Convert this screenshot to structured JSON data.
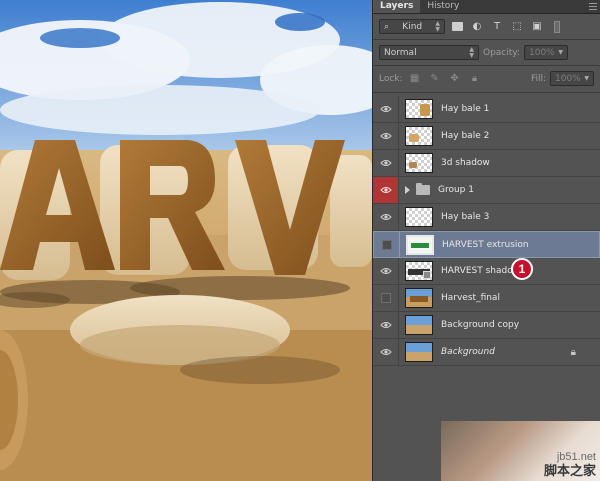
{
  "panel": {
    "tabs": [
      {
        "label": "Layers"
      },
      {
        "label": "History"
      }
    ],
    "filter": {
      "kind": "Kind"
    },
    "blend": {
      "mode": "Normal",
      "opacity_label": "Opacity:",
      "opacity_value": "100%"
    },
    "lock": {
      "label": "Lock:",
      "fill_label": "Fill:",
      "fill_value": "100%"
    },
    "layers": [
      {
        "name": "Hay bale 1",
        "visible": true
      },
      {
        "name": "Hay bale 2",
        "visible": true
      },
      {
        "name": "3d shadow",
        "visible": true
      },
      {
        "name": "Group 1",
        "visible": true,
        "group": true
      },
      {
        "name": "Hay bale 3",
        "visible": true
      },
      {
        "name": "HARVEST extrusion",
        "visible": false,
        "selected": true
      },
      {
        "name": "HARVEST shadow",
        "visible": true
      },
      {
        "name": "Harvest_final",
        "visible": false
      },
      {
        "name": "Background copy",
        "visible": true
      },
      {
        "name": "Background",
        "visible": true,
        "locked": true
      }
    ],
    "badge": "1"
  },
  "watermark": {
    "site": "jb51.net",
    "brand": "脚本之家"
  },
  "colors": {
    "panel": "#535353",
    "selected": "#6d7a93",
    "group_eye": "#b23535",
    "badge": "#c8102e"
  }
}
